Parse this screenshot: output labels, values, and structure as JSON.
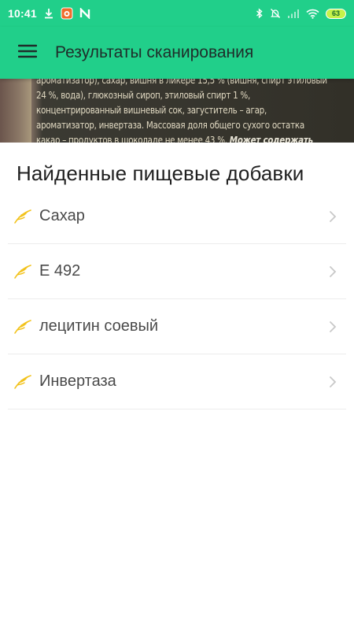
{
  "status_bar": {
    "time": "10:41",
    "battery": "63",
    "left_icons": [
      "download-icon",
      "app-notification-icon",
      "n-app-icon"
    ],
    "right_icons": [
      "bluetooth-icon",
      "mute-icon",
      "signal-icon",
      "wifi-icon",
      "battery-icon"
    ]
  },
  "app_bar": {
    "title": "Результаты сканирования",
    "menu_icon": "hamburger-menu-icon"
  },
  "scan_photo": {
    "lines": [
      "ароматизатор), сахар, вишня в ликере 15,5 % (вишня, спирт этиловый",
      "24 %, вода), глюкозный сироп, этиловый спирт 1 %,",
      "концентрированный вишневый сок, загуститель – агар,",
      "ароматизатор, инвертаза. Массовая доля общего сухого остатка",
      "какао – продуктов в шоколаде не менее 43 %."
    ],
    "line5_tail": "Может содержать"
  },
  "section": {
    "title": "Найденные пищевые добавки"
  },
  "additives": [
    {
      "label": "Сахар"
    },
    {
      "label": "E 492"
    },
    {
      "label": "лецитин соевый"
    },
    {
      "label": "Инвертаза"
    }
  ],
  "colors": {
    "primary": "#21cf8a",
    "feather": "#f2c21b",
    "chevron": "#c8c8c8"
  }
}
